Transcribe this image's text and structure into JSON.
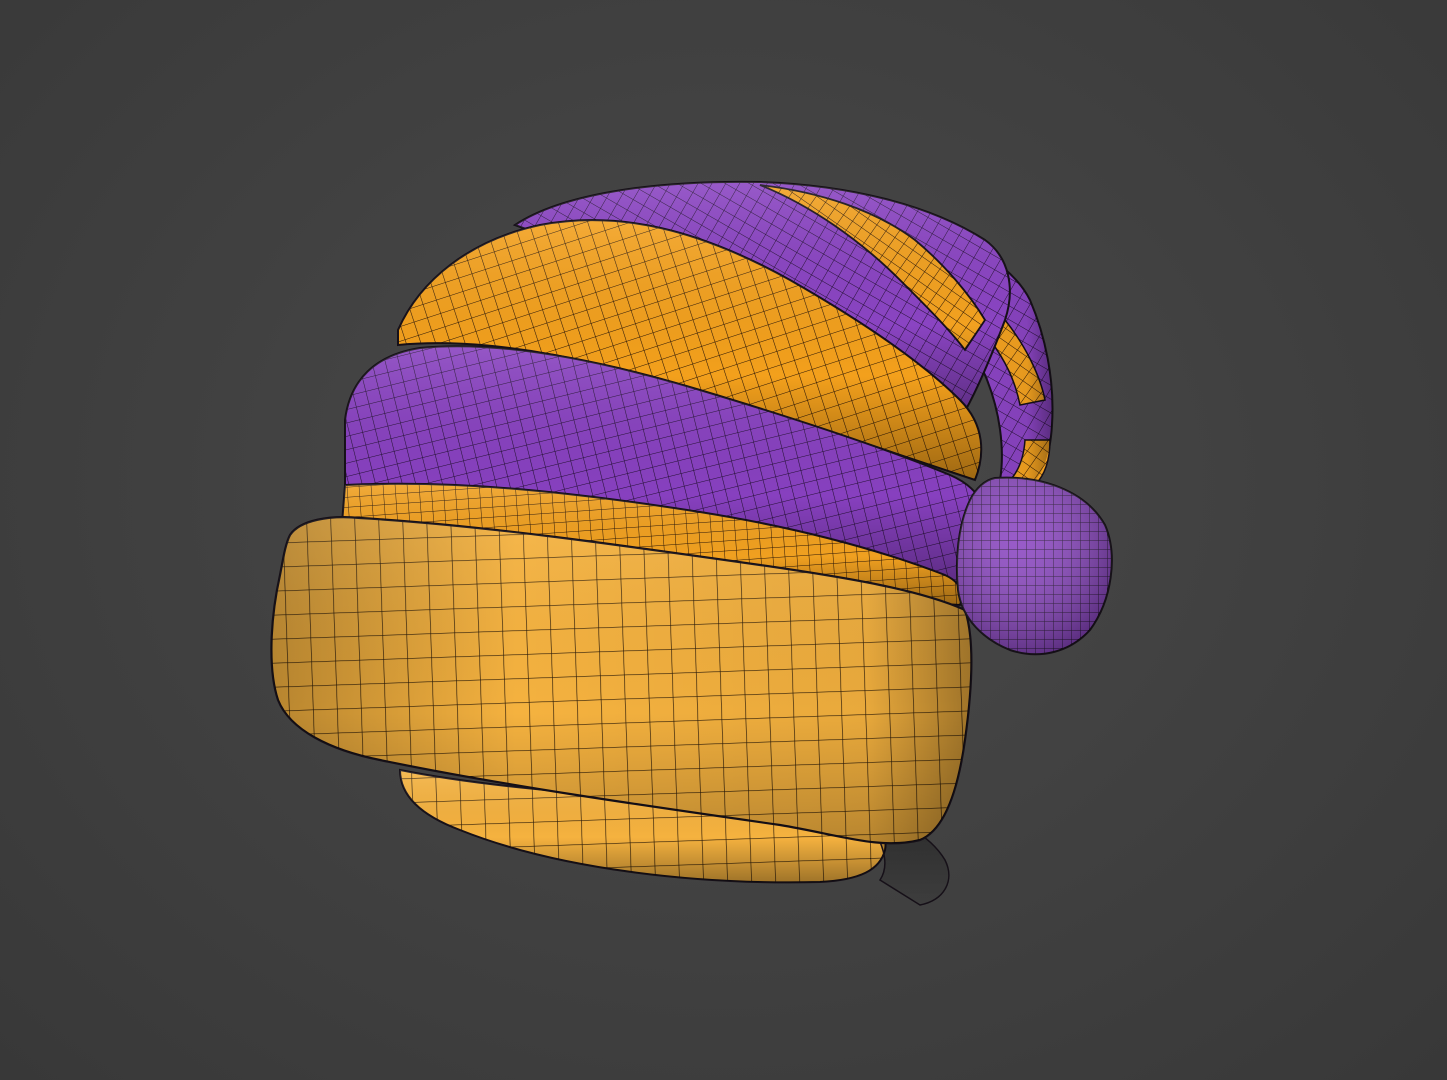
{
  "scene": {
    "subject": "hat-mesh",
    "display_mode": "shaded-wireframe",
    "material_colors": {
      "primary": "#f6a51a",
      "secondary": "#8a45c0",
      "cuff": "#f4b43c",
      "wire": "#1a1020"
    },
    "background_color": "#404040"
  }
}
